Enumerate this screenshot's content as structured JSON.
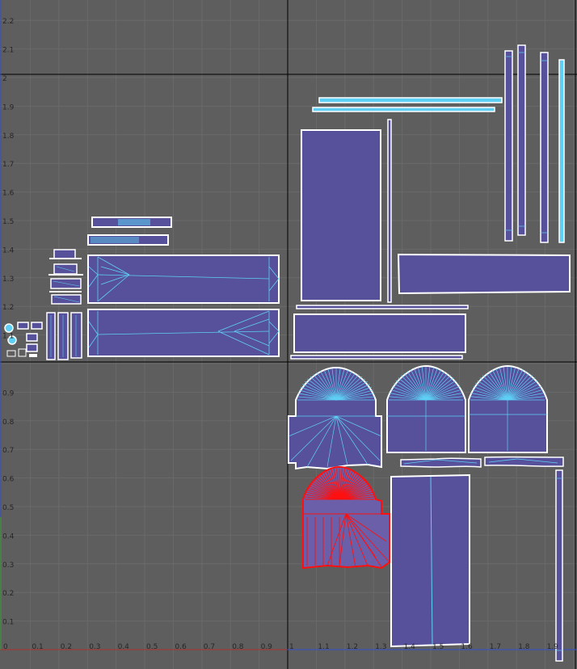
{
  "viewport": {
    "name": "uv-editor-viewport",
    "colors": {
      "background": "#5e5e5e",
      "grid_minor": "#6a6a6a",
      "grid_major": "#000000",
      "shell_fill": "#56519a",
      "shell_border": "#ffffff",
      "wire": "#5fd0f5",
      "selected": "#ff1010",
      "u_axis": "#b03030",
      "v_axis": "#3050d0",
      "tick_text": "#262626"
    }
  },
  "axes": {
    "u_ticks": [
      "0",
      "0.1",
      "0.2",
      "0.3",
      "0.4",
      "0.5",
      "0.6",
      "0.7",
      "0.8",
      "0.9",
      "1",
      "1.1",
      "1.2",
      "1.3",
      "1.4",
      "1.5",
      "1.6",
      "1.7",
      "1.8",
      "1.9"
    ],
    "v_ticks": [
      "0.1",
      "0.2",
      "0.3",
      "0.4",
      "0.5",
      "0.6",
      "0.7",
      "0.8",
      "0.9",
      "1.1",
      "1.2",
      "1.3",
      "1.4",
      "1.5",
      "1.6",
      "1.7",
      "1.8",
      "1.9",
      "2",
      "2.1",
      "2.2"
    ]
  },
  "uv_shells": [
    {
      "id": "long-panel-lower",
      "selected": false
    },
    {
      "id": "long-panel-upper",
      "selected": false
    },
    {
      "id": "strip-wide-upper",
      "selected": false
    },
    {
      "id": "strip-wide-lower",
      "selected": false
    },
    {
      "id": "large-vertical-panel",
      "selected": false
    },
    {
      "id": "wide-panel-right",
      "selected": false
    },
    {
      "id": "vertical-bars",
      "selected": false
    },
    {
      "id": "horizontal-bars",
      "selected": false
    },
    {
      "id": "bottom-rect-mid",
      "selected": false
    },
    {
      "id": "fan-shell-left",
      "selected": false
    },
    {
      "id": "fan-shell-mid",
      "selected": false
    },
    {
      "id": "fan-shell-right",
      "selected": false
    },
    {
      "id": "fan-shell-selected",
      "selected": true
    },
    {
      "id": "tall-panel-bottom",
      "selected": false
    },
    {
      "id": "thin-pole-right",
      "selected": false
    },
    {
      "id": "small-pieces-left",
      "selected": false
    }
  ]
}
